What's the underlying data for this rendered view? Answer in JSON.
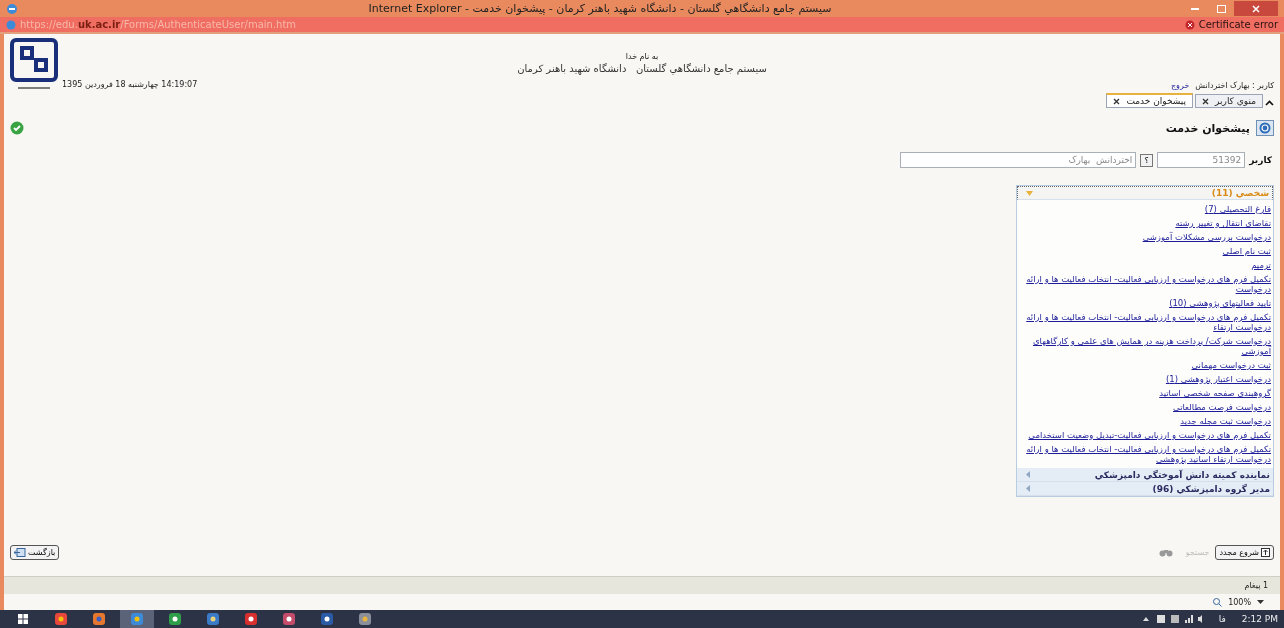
{
  "window": {
    "title": "سيستم جامع دانشگاهي گلستان - دانشگاه شهيد باهنر کرمان - پيشخوان خدمت - Internet Explorer"
  },
  "address_bar": {
    "url": "https://edu.**uk.ac.ir**/Forms/AuthenticateUser/main.htm",
    "certificate": "Certificate error"
  },
  "header": {
    "invocation": "به نام خدا",
    "system_title": "سيستم جامع دانشگاهي گلستان   دانشگاه شهيد باهنر کرمان",
    "datetime": "14:19:07 چهارشنبه 18 فروردين 1395",
    "user_label": "کاربر : بهارک اختردانش",
    "logout": "خروج"
  },
  "tabs": [
    {
      "label": "منوي کاربر",
      "selected": false
    },
    {
      "label": "پيشخوان خدمت",
      "selected": true
    }
  ],
  "page_title": "پيشخوان خدمت",
  "user_row": {
    "label": "کاربر",
    "code": "51392",
    "help": "؟",
    "name": "اختردانش  بهارک"
  },
  "groups": [
    {
      "title": "شخصي (11)",
      "expanded": true,
      "items": [
        "فارغ التحصیلی (7)",
        "تقاضای انتقال و تغییر رشته",
        "درخواست بررسی مشکلات آموزشی",
        "ثبت نام اصلی",
        "ترمیم",
        "تکمیل فرم های درخواست و ارزیابی فعالیت- انتخاب فعالیت ها و ارائه درخواست",
        "تایید فعالیتهای پژوهشی (10)",
        "تکمیل فرم های درخواست و ارزیابی فعالیت- انتخاب فعالیت ها و ارائه درخواست ارتقاء",
        "درخواست شرکت/ پرداخت هزینه در همایش های علمی و کارگاههای آموزشی",
        "ثبت درخواست مهمانی",
        "درخواست اعتبار پژوهشی (1)",
        "گروهبندی صفحه شخصی اساتید",
        "درخواست فرصت مطالعاتی",
        "درخواست ثبت مجله جدید",
        "تکمیل فرم های درخواست و ارزیابی فعالیت-تبدیل وضعیت استخدامی",
        "تکمیل فرم های درخواست و ارزیابی فعالیت- انتخاب فعالیت ها و ارائه درخواست ارتقاء اساتید پژوهشی"
      ]
    },
    {
      "title": "نماينده کميته دانش آموختگي دامپزشکي",
      "expanded": false
    },
    {
      "title": "مدير گروه دامپزشکي (96)",
      "expanded": false
    }
  ],
  "bottom": {
    "back": "بازگشت",
    "search_placeholder": "جستجو",
    "restart": "شروع مجدد"
  },
  "status_bar": {
    "messages": "1 پيغام",
    "zoom": "100%"
  },
  "taskbar": {
    "language": "فا",
    "time": "2:12 PM"
  }
}
